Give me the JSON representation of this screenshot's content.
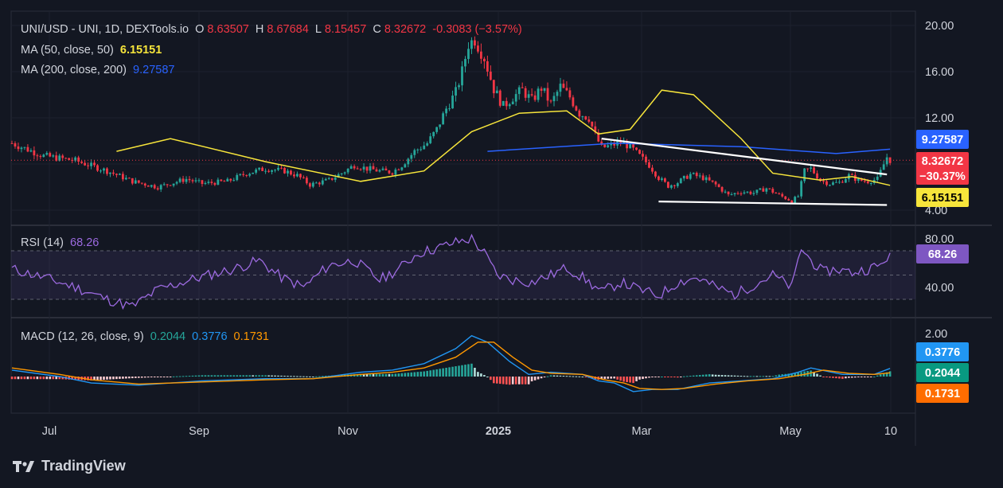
{
  "header": {
    "symbol": "UNI/USD - UNI, 1D, DEXTools.io",
    "o_label": "O",
    "o_value": "8.63507",
    "h_label": "H",
    "h_value": "8.67684",
    "l_label": "L",
    "l_value": "8.15457",
    "c_label": "C",
    "c_value": "8.32672",
    "change": "-0.3083 (−3.57%)"
  },
  "ma50": {
    "label": "MA (50, close, 50)",
    "value": "6.15151"
  },
  "ma200": {
    "label": "MA (200, close, 200)",
    "value": "9.27587"
  },
  "rsi": {
    "label": "RSI (14)",
    "value": "68.26"
  },
  "macd": {
    "label": "MACD (12, 26, close, 9)",
    "hist": "0.2044",
    "macd": "0.3776",
    "signal": "0.1731"
  },
  "price_tags": {
    "ma200": "9.27587",
    "close": "8.32672",
    "pct": "−30.37%",
    "ma50": "6.15151"
  },
  "colors": {
    "up": "#26a69a",
    "down": "#f23645",
    "ma50": "#f7e53b",
    "ma200": "#2962ff",
    "rsi": "#9c6ae0",
    "macd": "#2196f3",
    "signal": "#ff9800",
    "bg": "#131722"
  },
  "brand": "TradingView",
  "chart_data": [
    {
      "type": "candlestick",
      "title": "UNI/USD - UNI, 1D, DEXTools.io",
      "x_ticks": [
        "Jul",
        "Sep",
        "Nov",
        "2025",
        "Mar",
        "May",
        "10"
      ],
      "y_ticks": [
        "20.00",
        "16.00",
        "12.00",
        "4.00"
      ],
      "ylim": [
        3.7,
        20.8
      ],
      "close_path": [
        [
          0,
          9.8
        ],
        [
          10,
          8.7
        ],
        [
          20,
          8.3
        ],
        [
          30,
          7.4
        ],
        [
          38,
          6.5
        ],
        [
          46,
          6.0
        ],
        [
          55,
          6.7
        ],
        [
          60,
          6.3
        ],
        [
          68,
          6.5
        ],
        [
          74,
          7.2
        ],
        [
          80,
          7.6
        ],
        [
          86,
          7.4
        ],
        [
          90,
          7.0
        ],
        [
          94,
          6.2
        ],
        [
          100,
          6.6
        ],
        [
          104,
          7.2
        ],
        [
          108,
          7.9
        ],
        [
          112,
          7.6
        ],
        [
          116,
          7.4
        ],
        [
          120,
          7.3
        ],
        [
          123,
          7.9
        ],
        [
          127,
          9.1
        ],
        [
          131,
          9.8
        ],
        [
          134,
          11.0
        ],
        [
          137,
          12.8
        ],
        [
          140,
          14.2
        ],
        [
          142,
          16.0
        ],
        [
          144,
          18.4
        ],
        [
          146,
          18.8
        ],
        [
          149,
          17.2
        ],
        [
          152,
          14.5
        ],
        [
          155,
          13.0
        ],
        [
          158,
          13.8
        ],
        [
          161,
          14.4
        ],
        [
          164,
          13.5
        ],
        [
          167,
          14.6
        ],
        [
          170,
          13.2
        ],
        [
          173,
          14.7
        ],
        [
          176,
          13.8
        ],
        [
          179,
          12.4
        ],
        [
          182,
          12.0
        ],
        [
          184,
          10.5
        ],
        [
          186,
          9.4
        ],
        [
          189,
          9.6
        ],
        [
          192,
          9.9
        ],
        [
          195,
          9.5
        ],
        [
          198,
          8.7
        ],
        [
          201,
          7.9
        ],
        [
          204,
          6.8
        ],
        [
          207,
          6.1
        ],
        [
          210,
          6.4
        ],
        [
          214,
          7.1
        ],
        [
          218,
          6.8
        ],
        [
          222,
          6.2
        ],
        [
          226,
          5.3
        ],
        [
          230,
          5.6
        ],
        [
          234,
          5.5
        ],
        [
          238,
          5.9
        ],
        [
          242,
          5.3
        ],
        [
          246,
          4.8
        ],
        [
          248,
          5.2
        ],
        [
          250,
          7.4
        ],
        [
          252,
          7.6
        ],
        [
          255,
          6.6
        ],
        [
          258,
          6.3
        ],
        [
          261,
          6.4
        ],
        [
          264,
          7.0
        ],
        [
          267,
          6.6
        ],
        [
          270,
          6.5
        ],
        [
          273,
          6.7
        ],
        [
          276,
          8.6
        ],
        [
          277,
          8.33
        ]
      ],
      "ma50": [
        [
          33,
          9.1
        ],
        [
          50,
          10.2
        ],
        [
          80,
          8.2
        ],
        [
          110,
          6.5
        ],
        [
          130,
          7.4
        ],
        [
          145,
          10.8
        ],
        [
          160,
          12.4
        ],
        [
          175,
          12.6
        ],
        [
          185,
          10.6
        ],
        [
          195,
          11.0
        ],
        [
          205,
          14.4
        ],
        [
          215,
          14.0
        ],
        [
          230,
          10.2
        ],
        [
          240,
          7.2
        ],
        [
          255,
          6.6
        ],
        [
          265,
          6.9
        ],
        [
          277,
          6.15
        ]
      ],
      "ma200": [
        [
          150,
          9.1
        ],
        [
          190,
          9.8
        ],
        [
          230,
          9.5
        ],
        [
          260,
          8.9
        ],
        [
          277,
          9.28
        ]
      ],
      "trendlines": [
        [
          [
            186,
            10.2
          ],
          [
            276,
            7.1
          ]
        ],
        [
          [
            204,
            4.75
          ],
          [
            276,
            4.45
          ]
        ]
      ],
      "last_close": 8.32672
    },
    {
      "type": "line",
      "title": "RSI (14)",
      "y_ticks": [
        "80.00",
        "40.00"
      ],
      "ylim": [
        20,
        83
      ],
      "bands": [
        70,
        50,
        30
      ],
      "values": [
        [
          0,
          55
        ],
        [
          10,
          48
        ],
        [
          20,
          40
        ],
        [
          30,
          30
        ],
        [
          38,
          24
        ],
        [
          46,
          38
        ],
        [
          55,
          45
        ],
        [
          62,
          50
        ],
        [
          70,
          55
        ],
        [
          78,
          62
        ],
        [
          85,
          48
        ],
        [
          92,
          40
        ],
        [
          100,
          58
        ],
        [
          108,
          62
        ],
        [
          116,
          46
        ],
        [
          122,
          55
        ],
        [
          128,
          68
        ],
        [
          134,
          72
        ],
        [
          140,
          77
        ],
        [
          145,
          80
        ],
        [
          149,
          68
        ],
        [
          153,
          50
        ],
        [
          158,
          46
        ],
        [
          164,
          44
        ],
        [
          170,
          50
        ],
        [
          175,
          56
        ],
        [
          180,
          48
        ],
        [
          186,
          36
        ],
        [
          192,
          44
        ],
        [
          198,
          38
        ],
        [
          204,
          33
        ],
        [
          210,
          44
        ],
        [
          216,
          48
        ],
        [
          222,
          40
        ],
        [
          228,
          34
        ],
        [
          234,
          42
        ],
        [
          240,
          50
        ],
        [
          246,
          40
        ],
        [
          249,
          72
        ],
        [
          252,
          62
        ],
        [
          256,
          52
        ],
        [
          260,
          55
        ],
        [
          265,
          52
        ],
        [
          270,
          55
        ],
        [
          274,
          58
        ],
        [
          277,
          68.26
        ]
      ]
    },
    {
      "type": "line",
      "title": "MACD (12, 26, close, 9)",
      "y_ticks": [
        "2.00"
      ],
      "ylim": [
        -1.3,
        2.6
      ],
      "macd": [
        [
          0,
          0.3
        ],
        [
          15,
          0
        ],
        [
          25,
          -0.3
        ],
        [
          40,
          -0.4
        ],
        [
          60,
          -0.2
        ],
        [
          80,
          -0.1
        ],
        [
          95,
          -0.1
        ],
        [
          110,
          0.2
        ],
        [
          120,
          0.3
        ],
        [
          130,
          0.6
        ],
        [
          140,
          1.3
        ],
        [
          145,
          1.9
        ],
        [
          150,
          1.6
        ],
        [
          157,
          0.7
        ],
        [
          163,
          0.1
        ],
        [
          170,
          0.2
        ],
        [
          180,
          0.1
        ],
        [
          185,
          -0.2
        ],
        [
          190,
          -0.3
        ],
        [
          196,
          -0.7
        ],
        [
          202,
          -0.6
        ],
        [
          210,
          -0.6
        ],
        [
          220,
          -0.3
        ],
        [
          230,
          -0.2
        ],
        [
          240,
          -0.1
        ],
        [
          248,
          0.2
        ],
        [
          252,
          0.4
        ],
        [
          262,
          0.1
        ],
        [
          272,
          0.1
        ],
        [
          277,
          0.3776
        ]
      ],
      "signal": [
        [
          0,
          0.4
        ],
        [
          15,
          0.1
        ],
        [
          25,
          -0.15
        ],
        [
          40,
          -0.35
        ],
        [
          60,
          -0.25
        ],
        [
          80,
          -0.15
        ],
        [
          95,
          -0.1
        ],
        [
          110,
          0.1
        ],
        [
          120,
          0.2
        ],
        [
          130,
          0.4
        ],
        [
          140,
          0.9
        ],
        [
          147,
          1.6
        ],
        [
          152,
          1.6
        ],
        [
          158,
          0.9
        ],
        [
          164,
          0.3
        ],
        [
          170,
          0.15
        ],
        [
          180,
          0.1
        ],
        [
          187,
          -0.15
        ],
        [
          193,
          -0.3
        ],
        [
          198,
          -0.55
        ],
        [
          205,
          -0.6
        ],
        [
          212,
          -0.55
        ],
        [
          222,
          -0.35
        ],
        [
          232,
          -0.2
        ],
        [
          242,
          -0.1
        ],
        [
          250,
          0.1
        ],
        [
          256,
          0.3
        ],
        [
          264,
          0.15
        ],
        [
          272,
          0.1
        ],
        [
          277,
          0.1731
        ]
      ],
      "last_hist": 0.2044
    }
  ]
}
